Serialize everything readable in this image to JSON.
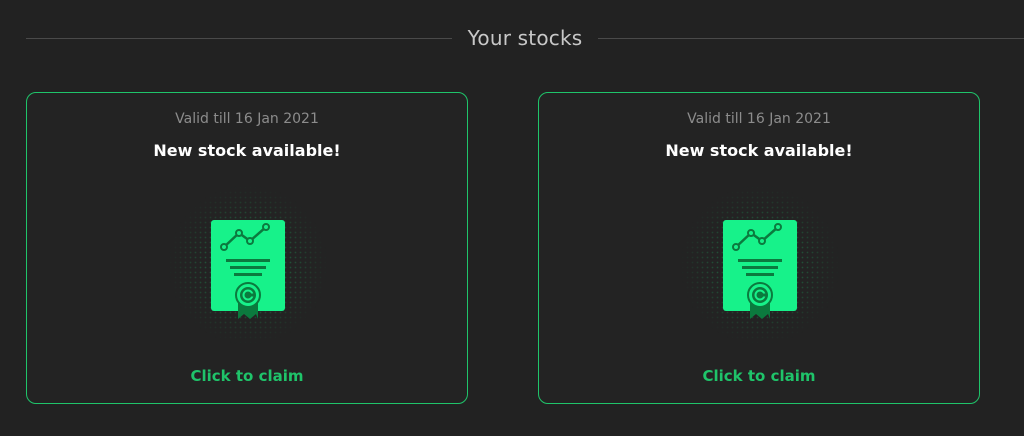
{
  "section": {
    "title": "Your stocks"
  },
  "colors": {
    "background": "#222222",
    "accent": "#1fc46a",
    "certificate": "#17f28a",
    "certificate_dark": "#0b7a3e"
  },
  "cards": [
    {
      "valid_text": "Valid till 16 Jan 2021",
      "title": "New stock available!",
      "icon": "stock-certificate-icon",
      "action_label": "Click to claim"
    },
    {
      "valid_text": "Valid till 16 Jan 2021",
      "title": "New stock available!",
      "icon": "stock-certificate-icon",
      "action_label": "Click to claim"
    }
  ]
}
